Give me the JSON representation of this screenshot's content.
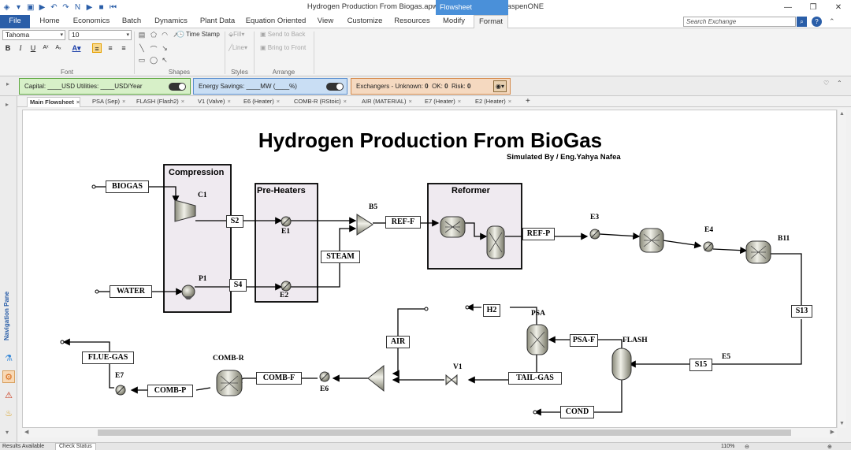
{
  "window": {
    "title": "Hydrogen Production From Biogas.apwz - Aspen Plus V11 - aspenONE",
    "context_tab": "Flowsheet"
  },
  "ribbon_tabs": [
    "File",
    "Home",
    "Economics",
    "Batch",
    "Dynamics",
    "Plant Data",
    "Equation Oriented",
    "View",
    "Customize",
    "Resources",
    "Modify",
    "Format"
  ],
  "search": {
    "placeholder": "Search Exchange"
  },
  "ribbon": {
    "font_name": "Tahoma",
    "font_size": "10",
    "time_stamp": "Time Stamp",
    "fill": "Fill",
    "line": "Line",
    "send_to_back": "Send to Back",
    "bring_to_front": "Bring to Front",
    "groups": {
      "font": "Font",
      "shapes": "Shapes",
      "styles": "Styles",
      "arrange": "Arrange"
    }
  },
  "infobar": {
    "capital": "Capital: ____USD  Utilities: ____USD/Year",
    "energy": "Energy Savings: ____MW   (____%)",
    "exchangers": "Exchangers -  Unknown:",
    "unknown": "0",
    "ok_label": "OK:",
    "ok": "0",
    "risk_label": "Risk:",
    "risk": "0"
  },
  "nav_pane": "Navigation Pane",
  "doc_tabs": [
    "Main Flowsheet",
    "PSA (Sep)",
    "FLASH (Flash2)",
    "V1 (Valve)",
    "E6 (Heater)",
    "COMB-R (RStoic)",
    "AIR (MATERIAL)",
    "E7 (Heater)",
    "E2 (Heater)"
  ],
  "flowsheet": {
    "title": "Hydrogen Production From BioGas",
    "subtitle": "Simulated By / Eng.Yahya Nafea",
    "blocks": {
      "compression": "Compression",
      "preheaters": "Pre-Heaters",
      "reformer": "Reformer"
    },
    "units": {
      "c1": "C1",
      "p1": "P1",
      "e1": "E1",
      "e2": "E2",
      "b5": "B5",
      "e3": "E3",
      "e4": "E4",
      "b11": "B11",
      "e5": "E5",
      "psa": "PSA",
      "flash": "FLASH",
      "v1": "V1",
      "e6": "E6",
      "combr": "COMB-R",
      "e7": "E7"
    },
    "streams": {
      "biogas": "BIOGAS",
      "water": "WATER",
      "s2": "S2",
      "s4": "S4",
      "steam": "STEAM",
      "reff": "REF-F",
      "refp": "REF-P",
      "s13": "S13",
      "s15": "S15",
      "h2": "H2",
      "psaf": "PSA-F",
      "tailgas": "TAIL-GAS",
      "cond": "COND",
      "air": "AIR",
      "combf": "COMB-F",
      "combp": "COMB-P",
      "fluegas": "FLUE-GAS"
    }
  },
  "status": {
    "results": "Results Available",
    "check": "Check Status",
    "zoom": "110%"
  }
}
